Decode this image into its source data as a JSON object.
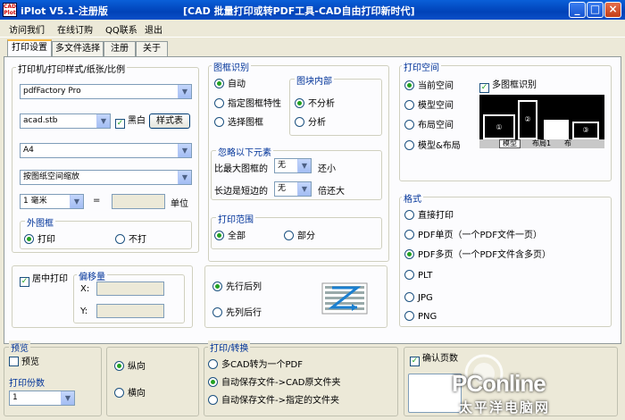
{
  "window": {
    "app_title": "iPlot V5.1-注册版",
    "caption": "[CAD 批量打印或转PDF工具-CAD自由打印新时代]",
    "icon_text": "CAD Plot",
    "min": "_",
    "max": "□",
    "close": "×"
  },
  "menu": [
    "访问我们",
    "在线订购",
    "QQ联系",
    "退出"
  ],
  "tabs": [
    "打印设置",
    "多文件选择",
    "注册",
    "关于"
  ],
  "printer": {
    "title": "打印机/打印样式/纸张/比例",
    "printer": "pdfFactory Pro",
    "style": "acad.stb",
    "bw": "黑白",
    "style_btn": "样式表",
    "paper": "A4",
    "scale": "按图纸空间缩放",
    "unit_value": "1 毫米",
    "equals": "=",
    "unit_label": "单位"
  },
  "frame": {
    "title": "外图框",
    "print": "打印",
    "noprint": "不打"
  },
  "recog": {
    "title": "图框识别",
    "auto": "自动",
    "specified": "指定图框特性",
    "select": "选择图框"
  },
  "block": {
    "title": "图块内部",
    "no": "不分析",
    "yes": "分析"
  },
  "ignore": {
    "title": "忽略以下元素",
    "row1_pre": "比最大图框的",
    "row1_val": "无",
    "row1_post": "还小",
    "row2_pre": "长边是短边的",
    "row2_val": "无",
    "row2_post": "倍还大"
  },
  "range": {
    "title": "打印范围",
    "all": "全部",
    "part": "部分"
  },
  "space": {
    "title": "打印空间",
    "current": "当前空间",
    "model": "模型空间",
    "layout": "布局空间",
    "both": "模型&布局",
    "multi": "多图框识别",
    "tab_model": "模型",
    "tab_layout": "布局1",
    "tab_extra": "布"
  },
  "format": {
    "title": "格式",
    "direct": "直接打印",
    "pdf_single": "PDF单页（一个PDF文件一页）",
    "pdf_multi": "PDF多页（一个PDF文件含多页）",
    "plt": "PLT",
    "jpg": "JPG",
    "png": "PNG"
  },
  "center": {
    "label": "居中打印",
    "offset": "偏移量",
    "x": "X:",
    "y": "Y:"
  },
  "order": {
    "col": "先行后列",
    "row": "先列后行"
  },
  "preview": {
    "title": "预览",
    "check": "预览",
    "copies_title": "打印份数",
    "copies": "1"
  },
  "orient": {
    "portrait": "纵向",
    "landscape": "横向"
  },
  "convert": {
    "title": "打印/转换",
    "one_pdf": "多CAD转为一个PDF",
    "auto_orig": "自动保存文件->CAD原文件夹",
    "auto_spec": "自动保存文件->指定的文件夹"
  },
  "confirm": {
    "label": "确认页数"
  },
  "watermark": {
    "brand": "PConline",
    "site": "太平洋电脑网"
  }
}
